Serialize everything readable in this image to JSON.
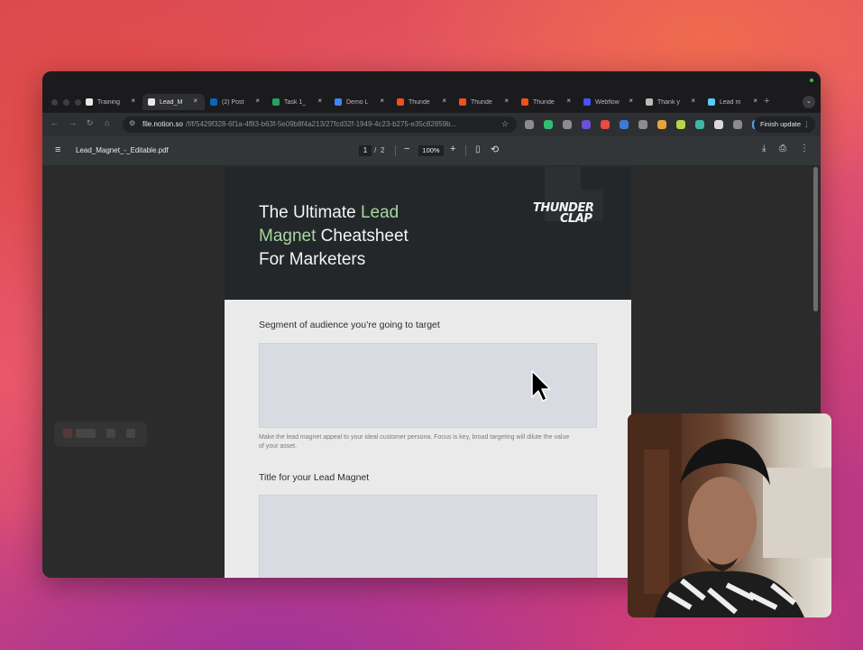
{
  "browser": {
    "tabs": [
      {
        "label": "Training",
        "icon": "notion-icon",
        "color": "#e8e8e8",
        "active": false
      },
      {
        "label": "Lead_M",
        "icon": "notion-icon",
        "color": "#e8e8e8",
        "active": true
      },
      {
        "label": "(2) Post",
        "icon": "linkedin-icon",
        "color": "#0a66c2",
        "active": false
      },
      {
        "label": "Task 1_",
        "icon": "sheets-icon",
        "color": "#1fa463",
        "active": false
      },
      {
        "label": "Demo L",
        "icon": "docs-icon",
        "color": "#4285f4",
        "active": false
      },
      {
        "label": "Thunde",
        "icon": "figma-icon",
        "color": "#f24e1e",
        "active": false
      },
      {
        "label": "Thunde",
        "icon": "figma-icon",
        "color": "#f24e1e",
        "active": false
      },
      {
        "label": "Thunde",
        "icon": "figma-icon",
        "color": "#f24e1e",
        "active": false
      },
      {
        "label": "Webflow",
        "icon": "webflow-icon",
        "color": "#4353ff",
        "active": false
      },
      {
        "label": "Thank y",
        "icon": "globe-icon",
        "color": "#bbbbbb",
        "active": false
      },
      {
        "label": "Lead m",
        "icon": "globe-icon",
        "color": "#5ac8fa",
        "active": false
      }
    ],
    "new_tab": "+",
    "tab_close": "×",
    "url_host": "file.notion.so",
    "url_path": "/f/f/5429f328-6f1a-4f83-b63f-5e09b8f4a213/27fcd32f-1949-4c23-b275-e35c82859b...",
    "finish_update": "Finish update",
    "extension_colors": [
      "#8c8c8c",
      "#2fbf71",
      "#8c8c8c",
      "#6b4fd8",
      "#e84c3d",
      "#3d7bd9",
      "#8c8c8c",
      "#e8a33d",
      "#b7d44a",
      "#3fb6a8",
      "#d9d9d9",
      "#8c8c8c",
      "#4aa3e8"
    ]
  },
  "pdf": {
    "filename": "Lead_Magnet_-_Editable.pdf",
    "page_current": "1",
    "page_separator": "/",
    "page_total": "2",
    "zoom": "100%"
  },
  "doc": {
    "title_part1": "The Ultimate ",
    "title_highlight1": "Lead",
    "title_highlight2": "Magnet",
    "title_part2": " Cheatsheet",
    "title_part3": "For Marketers",
    "logo_line1": "THUNDER",
    "logo_line2": "CLAP",
    "section1_label": "Segment of audience you’re going to target",
    "section1_help": "Make the lead magnet appeal to your ideal customer persona. Focus is key, broad targeting will dilute the value of your asset.",
    "section2_label": "Title for your Lead Magnet"
  },
  "colors": {
    "accent_green": "#a6d6a0",
    "hero_bg": "#23272a",
    "field_bg": "#d9dbe2"
  }
}
